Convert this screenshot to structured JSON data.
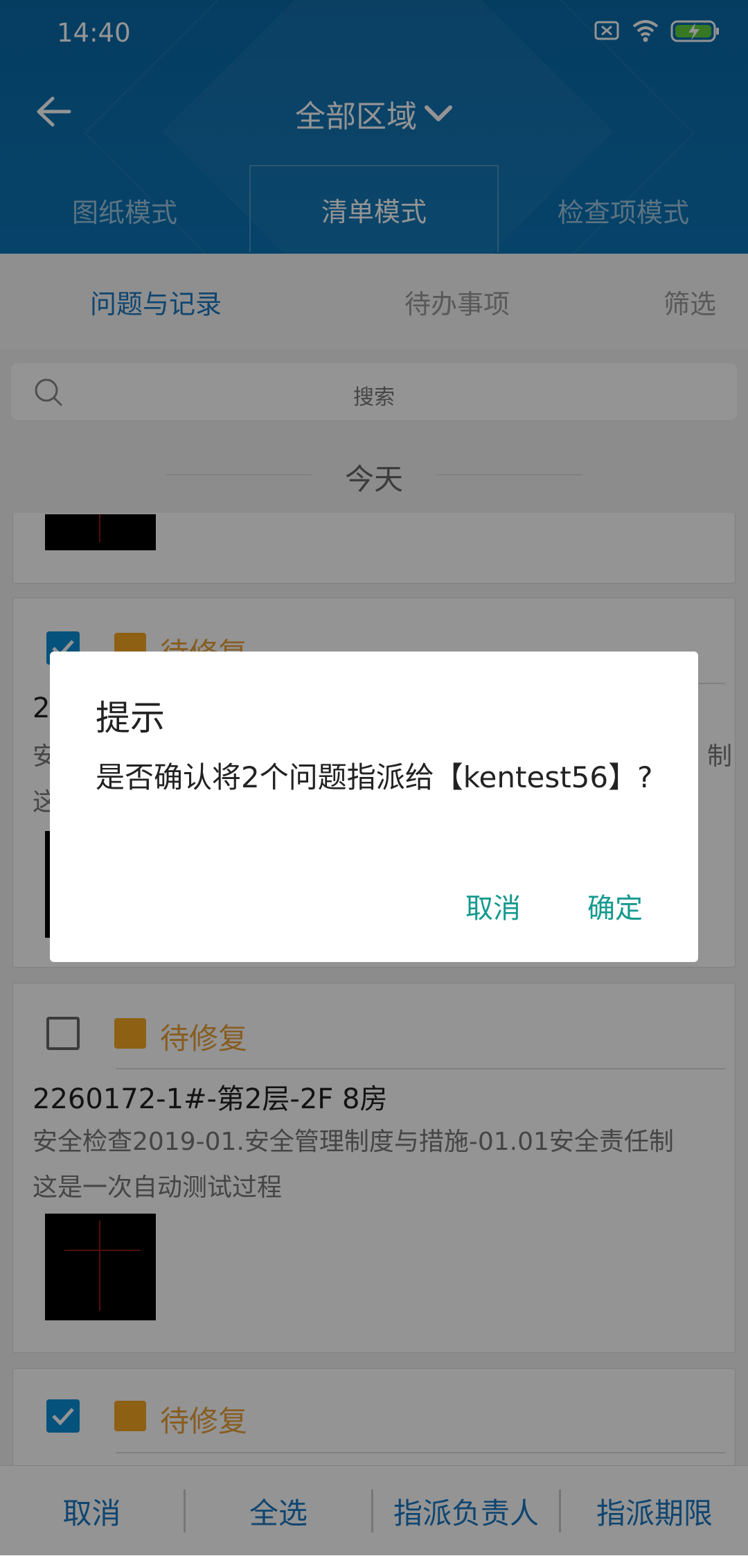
{
  "status_bar": {
    "time": "14:40"
  },
  "header": {
    "title": "全部区域",
    "back_icon": "back-arrow-icon",
    "dropdown_icon": "chevron-down-icon"
  },
  "mode_tabs": [
    {
      "label": "图纸模式",
      "active": false
    },
    {
      "label": "清单模式",
      "active": true
    },
    {
      "label": "检查项模式",
      "active": false
    }
  ],
  "sub_tabs": [
    {
      "label": "问题与记录",
      "active": true
    },
    {
      "label": "待办事项",
      "active": false
    }
  ],
  "filter_label": "筛选",
  "search": {
    "placeholder": "搜索"
  },
  "section_header": "今天",
  "cards": [
    {
      "checked": true,
      "status": "待修复",
      "title": "2",
      "desc_line1": "安",
      "desc_line2": "这",
      "desc_tail": "制"
    },
    {
      "checked": false,
      "status": "待修复",
      "title": "2260172-1#-第2层-2F 8房",
      "desc_line1": "安全检查2019-01.安全管理制度与措施-01.01安全责任制",
      "desc_line2": "这是一次自动测试过程"
    },
    {
      "checked": true,
      "status": "待修复"
    }
  ],
  "bottom_bar": {
    "cancel": "取消",
    "select_all": "全选",
    "assign_owner": "指派负责人",
    "assign_deadline": "指派期限"
  },
  "dialog": {
    "title": "提示",
    "message": "是否确认将2个问题指派给【kentest56】?",
    "cancel": "取消",
    "confirm": "确定"
  },
  "colors": {
    "header": "#0b74b6",
    "accent": "#1a78c2",
    "status": "#e8a03a",
    "dialog_button": "#159a8f"
  }
}
